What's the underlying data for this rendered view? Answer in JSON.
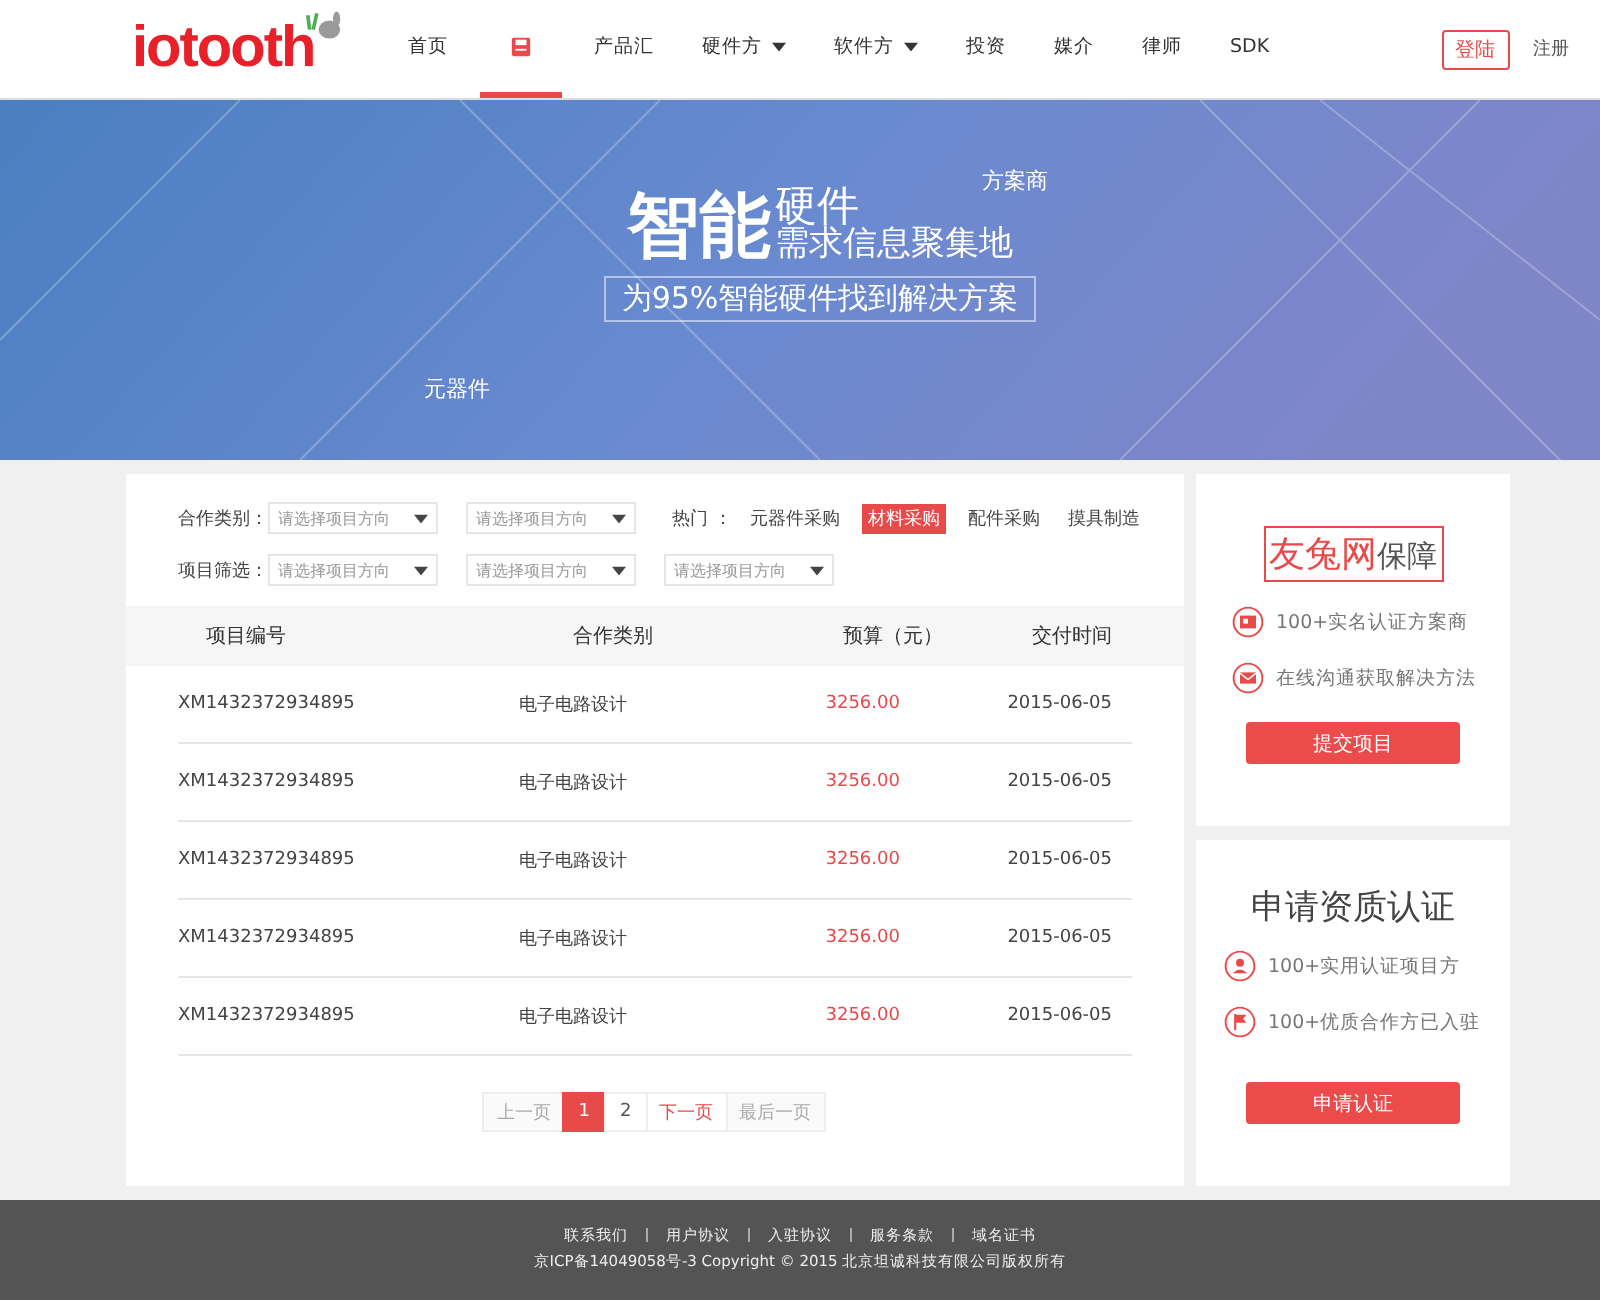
{
  "header": {
    "logo": "iotooth",
    "nav": [
      {
        "label": "首页",
        "kind": "text",
        "selected": false,
        "dropdown": false
      },
      {
        "kind": "icon",
        "selected": true,
        "dropdown": false
      },
      {
        "label": "产品汇",
        "kind": "text",
        "selected": false,
        "dropdown": false
      },
      {
        "label": "硬件方",
        "kind": "text",
        "selected": false,
        "dropdown": true
      },
      {
        "label": "软件方",
        "kind": "text",
        "selected": false,
        "dropdown": true
      },
      {
        "label": "投资",
        "kind": "text",
        "selected": false,
        "dropdown": false
      },
      {
        "label": "媒介",
        "kind": "text",
        "selected": false,
        "dropdown": false
      },
      {
        "label": "律师",
        "kind": "text",
        "selected": false,
        "dropdown": false
      },
      {
        "label": "SDK",
        "kind": "text",
        "selected": false,
        "dropdown": false
      }
    ],
    "login": "登陆",
    "register": "注册"
  },
  "banner": {
    "title_big": "智能",
    "title_small": "硬件",
    "subtitle": "需求信息聚集地",
    "tagline": "为95%智能硬件找到解决方案",
    "label_right": "方案商",
    "label_left": "元器件"
  },
  "filters": {
    "row_1": {
      "label": "合作类别：",
      "selects": [
        {
          "placeholder": "请选择项目方向"
        },
        {
          "placeholder": "请选择项目方向"
        }
      ],
      "hot_label": "热门 ：",
      "hot_tags": [
        {
          "label": "元器件采购",
          "selected": false
        },
        {
          "label": "材料采购",
          "selected": true
        },
        {
          "label": "配件采购",
          "selected": false
        },
        {
          "label": "摸具制造",
          "selected": false
        }
      ]
    },
    "row_2": {
      "label": "项目筛选：",
      "selects": [
        {
          "placeholder": "请选择项目方向"
        },
        {
          "placeholder": "请选择项目方向"
        },
        {
          "placeholder": "请选择项目方向"
        }
      ]
    }
  },
  "table": {
    "columns": [
      "项目编号",
      "合作类别",
      "预算（元）",
      "交付时间"
    ],
    "rows": [
      [
        "XM1432372934895",
        "电子电路设计",
        "3256.00",
        "2015-06-05"
      ],
      [
        "XM1432372934895",
        "电子电路设计",
        "3256.00",
        "2015-06-05"
      ],
      [
        "XM1432372934895",
        "电子电路设计",
        "3256.00",
        "2015-06-05"
      ],
      [
        "XM1432372934895",
        "电子电路设计",
        "3256.00",
        "2015-06-05"
      ],
      [
        "XM1432372934895",
        "电子电路设计",
        "3256.00",
        "2015-06-05"
      ]
    ]
  },
  "pagination": [
    {
      "label": "上一页",
      "kind": "nav",
      "selected": false,
      "disabled": true
    },
    {
      "label": "1",
      "kind": "page",
      "selected": true,
      "disabled": false
    },
    {
      "label": "2",
      "kind": "page",
      "selected": false,
      "disabled": false
    },
    {
      "label": "下一页",
      "kind": "nav",
      "selected": false,
      "disabled": false
    },
    {
      "label": "最后一页",
      "kind": "nav",
      "selected": false,
      "disabled": true
    }
  ],
  "guarantee_card": {
    "brand": "友兔网",
    "title": "保障",
    "items": [
      {
        "kind": "id",
        "text": "100+实名认证方案商"
      },
      {
        "kind": "mail",
        "text": "在线沟通获取解决方法"
      }
    ],
    "button": "提交项目"
  },
  "certify_card": {
    "title": "申请资质认证",
    "items": [
      {
        "kind": "user",
        "text": "100+实用认证项目方"
      },
      {
        "kind": "flag",
        "text": "100+优质合作方已入驻"
      }
    ],
    "button": "申请认证"
  },
  "footer": {
    "links": [
      "联系我们",
      "用户协议",
      "入驻协议",
      "服务条款",
      "域名证书"
    ],
    "copyright": "京ICP备14049058号-3 Copyright © 2015  北京坦诚科技有限公司版权所有"
  }
}
